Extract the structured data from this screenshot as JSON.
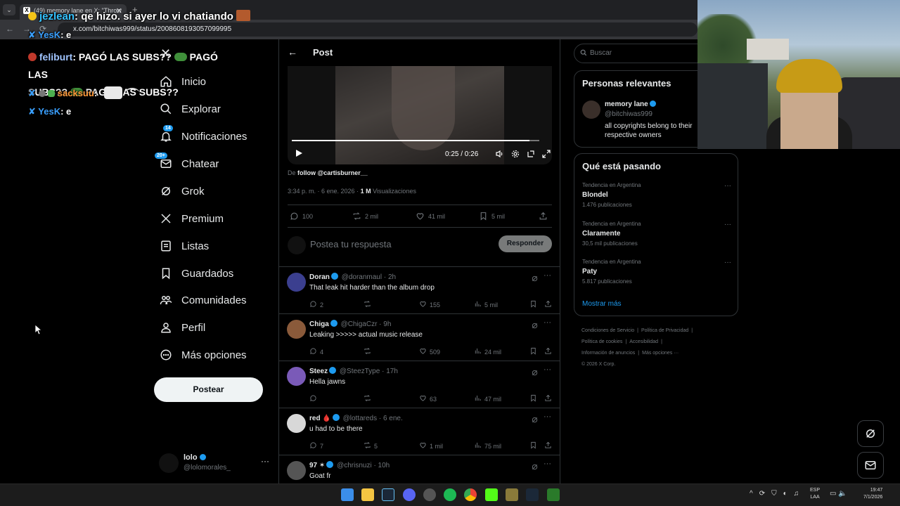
{
  "browser": {
    "tab_title": "(49) memory lane en X: \"Throw",
    "url": "x.com/bitchiwas999/status/2008608193057099995"
  },
  "chat": {
    "line0": {
      "user": "jezlean",
      "message": ": qe hizo. si ayer lo vi chatiando"
    },
    "line1": {
      "user": "YesK",
      "message": ": e"
    },
    "line2": {
      "user": "feliburt",
      "message": ": PAGÓ LAS SUBS??",
      "cont1": "PAGÓ LAS",
      "cont2": "SUBS??",
      "cont3": "PAGÓ LAS SUBS??"
    },
    "line3": {
      "user": "sacksuu",
      "message": ":"
    },
    "line4": {
      "user": "YesK",
      "message": ": e"
    }
  },
  "nav": {
    "items": [
      {
        "label": "Inicio",
        "icon": "home-icon"
      },
      {
        "label": "Explorar",
        "icon": "search-icon"
      },
      {
        "label": "Notificaciones",
        "icon": "bell-icon",
        "badge": "14"
      },
      {
        "label": "Chatear",
        "icon": "mail-icon",
        "badge": "20+"
      },
      {
        "label": "Grok",
        "icon": "grok-icon"
      },
      {
        "label": "Premium",
        "icon": "x-logo-icon"
      },
      {
        "label": "Listas",
        "icon": "list-icon"
      },
      {
        "label": "Guardados",
        "icon": "bookmark-icon"
      },
      {
        "label": "Comunidades",
        "icon": "communities-icon"
      },
      {
        "label": "Perfil",
        "icon": "person-icon"
      },
      {
        "label": "Más opciones",
        "icon": "more-circle-icon"
      }
    ],
    "post_button": "Postear",
    "account": {
      "name": "lolo",
      "handle": "@lolomorales_",
      "more": "···"
    }
  },
  "post": {
    "header_title": "Post",
    "video": {
      "time": "0:25 / 0:26",
      "progress": 0.96
    },
    "from_prefix": "De ",
    "from_link": "follow @cartisburner__",
    "meta_time": "3:34 p. m. · 6 ene. 2026 · ",
    "meta_views_count": "1 M",
    "meta_views_label": " Visualizaciones",
    "stats": {
      "replies": "100",
      "reposts": "2 mil",
      "likes": "41 mil",
      "bookmarks": "5 mil"
    },
    "reply_placeholder": "Postea tu respuesta",
    "reply_button": "Responder"
  },
  "replies": [
    {
      "name": "Doran",
      "handle": "@doranmaul · 2h",
      "text": "That leak hit harder than the album drop",
      "replies": "2",
      "reposts": "",
      "likes": "155",
      "views": "5 mil",
      "avatar_color": "#3b3f8f"
    },
    {
      "name": "Chiga",
      "handle": "@ChigaCzr · 9h",
      "text": "Leaking >>>>> actual music release",
      "replies": "4",
      "reposts": "",
      "likes": "509",
      "views": "24 mil",
      "avatar_color": "#8a5a3a"
    },
    {
      "name": "Steez",
      "handle": "@SteezType · 17h",
      "text": "Hella jawns",
      "replies": "",
      "reposts": "",
      "likes": "63",
      "views": "47 mil",
      "avatar_color": "#7a5ab8"
    },
    {
      "name": "red 🩸",
      "handle": "@lottareds · 6 ene.",
      "text": "u had to be there",
      "replies": "7",
      "reposts": "5",
      "likes": "1 mil",
      "views": "75 mil",
      "avatar_color": "#d8d8d8"
    },
    {
      "name": "97 ✶",
      "handle": "@chrisnuzi · 10h",
      "text": "Goat fr",
      "replies": "",
      "reposts": "",
      "likes": "",
      "views": "",
      "avatar_color": "#555"
    }
  ],
  "right": {
    "search_placeholder": "Buscar",
    "relevant_title": "Personas relevantes",
    "relevant_user": {
      "name": "memory lane",
      "handle": "@bitchiwas999",
      "bio": "all copyrights belong to their respective owners"
    },
    "trending_title": "Qué está pasando",
    "trends": [
      {
        "context": "Tendencia en Argentina",
        "name": "Blondel",
        "count": "1.476 publicaciones"
      },
      {
        "context": "Tendencia en Argentina",
        "name": "Claramente",
        "count": "30,5 mil publicaciones"
      },
      {
        "context": "Tendencia en Argentina",
        "name": "Paty",
        "count": "5.817 publicaciones"
      }
    ],
    "show_more": "Mostrar más",
    "footer": [
      "Condiciones de Servicio",
      "|",
      "Política de Privacidad",
      "|",
      "Política de cookies",
      "|",
      "Accesibilidad",
      "|",
      "Información de anuncios",
      "|",
      "Más opciones ···",
      "© 2026 X Corp."
    ]
  },
  "taskbar": {
    "lang1": "ESP",
    "lang2": "LAA",
    "time": "19:47",
    "date": "7/1/2026"
  }
}
